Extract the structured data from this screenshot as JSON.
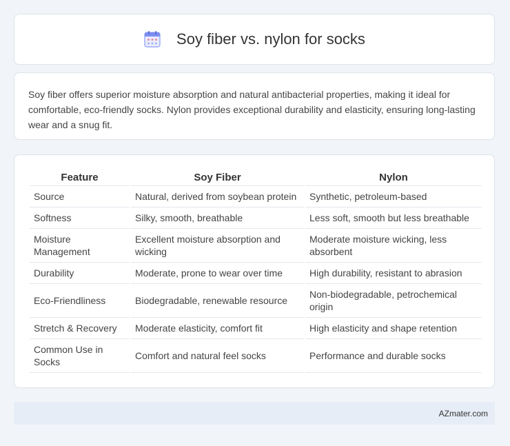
{
  "header": {
    "title": "Soy fiber vs. nylon for socks",
    "icon": "calendar-icon",
    "icon_color": "#7d8ef0"
  },
  "intro": {
    "text": "Soy fiber offers superior moisture absorption and natural antibacterial properties, making it ideal for comfortable, eco-friendly socks. Nylon provides exceptional durability and elasticity, ensuring long-lasting wear and a snug fit."
  },
  "table": {
    "headers": [
      "Feature",
      "Soy Fiber",
      "Nylon"
    ],
    "rows": [
      [
        "Source",
        "Natural, derived from soybean protein",
        "Synthetic, petroleum-based"
      ],
      [
        "Softness",
        "Silky, smooth, breathable",
        "Less soft, smooth but less breathable"
      ],
      [
        "Moisture Management",
        "Excellent moisture absorption and wicking",
        "Moderate moisture wicking, less absorbent"
      ],
      [
        "Durability",
        "Moderate, prone to wear over time",
        "High durability, resistant to abrasion"
      ],
      [
        "Eco-Friendliness",
        "Biodegradable, renewable resource",
        "Non-biodegradable, petrochemical origin"
      ],
      [
        "Stretch & Recovery",
        "Moderate elasticity, comfort fit",
        "High elasticity and shape retention"
      ],
      [
        "Common Use in Socks",
        "Comfort and natural feel socks",
        "Performance and durable socks"
      ]
    ]
  },
  "footer": {
    "text": "AZmater.com"
  }
}
